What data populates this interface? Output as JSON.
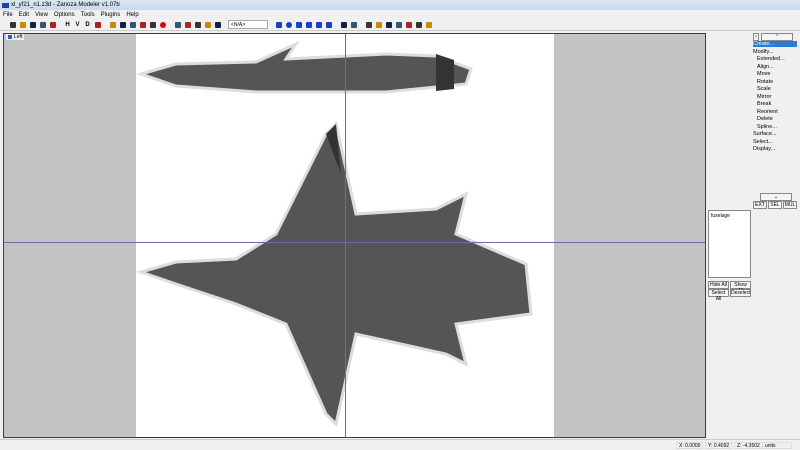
{
  "window": {
    "title": "xl_yf21_n1.z3d - Zanoza Modeler v1.07b"
  },
  "menu": [
    "File",
    "Edit",
    "View",
    "Options",
    "Tools",
    "Plugins",
    "Help"
  ],
  "toolbar": {
    "icons": [
      "new-icon",
      "open-icon",
      "save-icon",
      "save-as-icon",
      "revert-icon",
      "|",
      "H",
      "V",
      "D",
      "axes-icon",
      "|",
      "select-icon",
      "cube-view-1-icon",
      "cube-view-2-icon",
      "cube-view-3-icon",
      "cube-view-4-icon",
      "render-sphere-icon",
      "|",
      "zoom-icon",
      "pan-icon",
      "copy-view-icon",
      "view-a-icon",
      "view-b-icon"
    ],
    "zoom_value": "<N/A>",
    "icons2": [
      "box-icon",
      "sphere-icon",
      "cylinder-icon",
      "cone-icon",
      "torus-icon",
      "gear-icon",
      "|",
      "rect-select-icon",
      "circle-select-icon",
      "|",
      "tool-1-icon",
      "tool-2-icon",
      "tool-3-icon",
      "tool-4-icon",
      "tool-5-icon",
      "tool-6-icon",
      "tool-7-icon"
    ]
  },
  "viewport": {
    "label": "Left"
  },
  "panel": {
    "menu": [
      {
        "label": "Create...",
        "indent": 0,
        "selected": true
      },
      {
        "label": "Modify...",
        "indent": 0
      },
      {
        "label": "Extended...",
        "indent": 1
      },
      {
        "label": "Align...",
        "indent": 1
      },
      {
        "label": "Move",
        "indent": 1
      },
      {
        "label": "Rotate",
        "indent": 1
      },
      {
        "label": "Scale",
        "indent": 1
      },
      {
        "label": "Mirror",
        "indent": 1
      },
      {
        "label": "Break",
        "indent": 1
      },
      {
        "label": "Reorient",
        "indent": 1
      },
      {
        "label": "Delete",
        "indent": 1
      },
      {
        "label": "Spline...",
        "indent": 1
      },
      {
        "label": "Surface...",
        "indent": 0
      },
      {
        "label": "Select...",
        "indent": 0
      },
      {
        "label": "Display...",
        "indent": 0
      }
    ],
    "tabs": [
      "EXT",
      "SEL",
      "MUL"
    ],
    "objects": [
      "fuselage"
    ],
    "buttons": {
      "hide_all": "Hide All",
      "show_all": "Show All",
      "select_all": "Select All",
      "deselect": "Deselect"
    }
  },
  "status": {
    "x": "X: 0.0000",
    "y": "Y: 0.4092",
    "z": "Z: -4.3502",
    "units": "units"
  }
}
